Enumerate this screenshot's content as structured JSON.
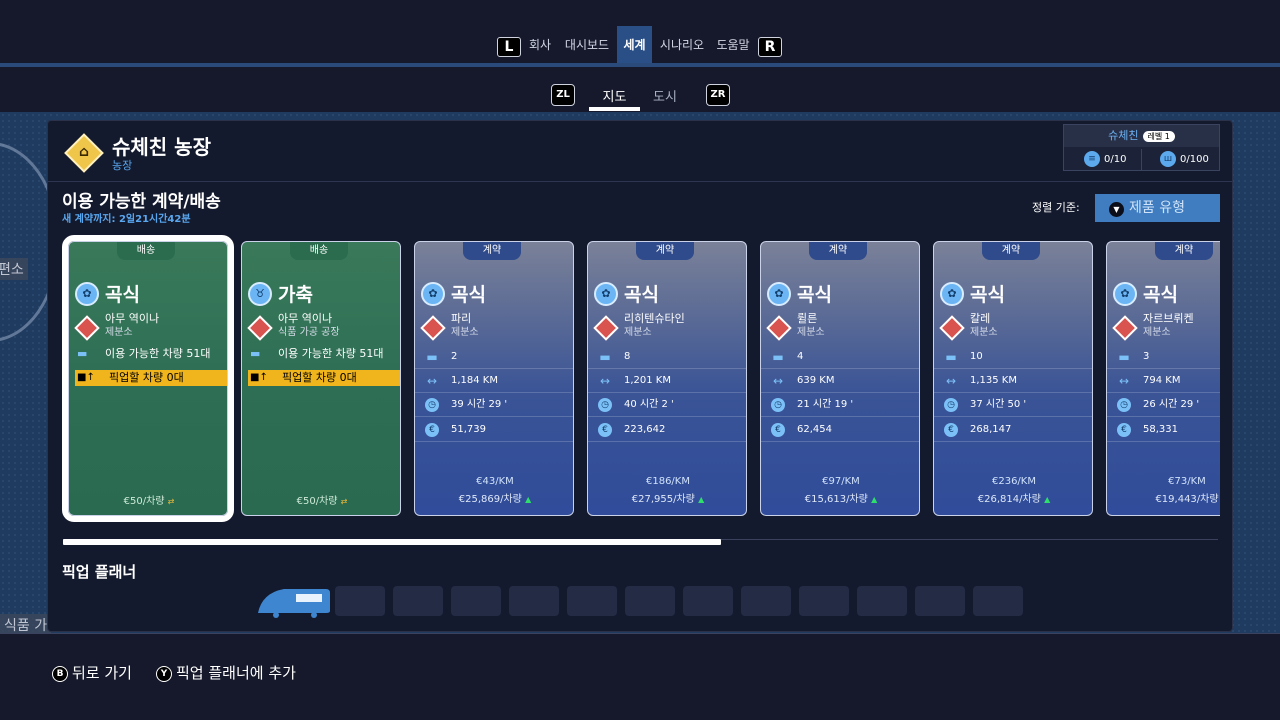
{
  "top_nav": {
    "left_button": "L",
    "right_button": "R",
    "tabs": [
      {
        "label": "회사",
        "active": false
      },
      {
        "label": "대시보드",
        "active": false
      },
      {
        "label": "세계",
        "active": true
      },
      {
        "label": "시나리오",
        "active": false
      },
      {
        "label": "도움말",
        "active": false
      }
    ]
  },
  "sub_nav": {
    "left_button": "ZL",
    "right_button": "ZR",
    "tabs": [
      {
        "label": "지도",
        "active": true
      },
      {
        "label": "도시",
        "active": false
      }
    ]
  },
  "map_labels": [
    "편소",
    "식품 가"
  ],
  "farm": {
    "icon": "farm-icon",
    "name": "슈체친 농장",
    "type": "농장",
    "info": {
      "city": "슈체친",
      "level": "레벨 1",
      "stat1": "0/10",
      "stat2": "0/100"
    }
  },
  "section": {
    "title": "이용 가능한 계약/배송",
    "new_contract": "새 계약까지: 2일21시간42분",
    "sort_label": "정렬 기준:",
    "sort_value": "제품 유형"
  },
  "cards": [
    {
      "kind": "배송",
      "category": "곡식",
      "dest": "아무 역이나",
      "dest_sub": "제분소",
      "available": "이용 가능한 차량 51대",
      "pickup": "픽업할 차량 0대",
      "price": "€50/차량"
    },
    {
      "kind": "배송",
      "category": "가축",
      "dest": "아무 역이나",
      "dest_sub": "식품 가공 공장",
      "available": "이용 가능한 차량 51대",
      "pickup": "픽업할 차량 0대",
      "price": "€50/차량"
    },
    {
      "kind": "계약",
      "category": "곡식",
      "dest": "파리",
      "dest_sub": "제분소",
      "vehicles": "2",
      "distance": "1,184 KM",
      "time": "39 시간 29 '",
      "money": "51,739",
      "rate": "€43/KM",
      "price": "€25,869/차량"
    },
    {
      "kind": "계약",
      "category": "곡식",
      "dest": "리히텐슈타인",
      "dest_sub": "제분소",
      "vehicles": "8",
      "distance": "1,201 KM",
      "time": "40 시간 2 '",
      "money": "223,642",
      "rate": "€186/KM",
      "price": "€27,955/차량"
    },
    {
      "kind": "계약",
      "category": "곡식",
      "dest": "륄른",
      "dest_sub": "제분소",
      "vehicles": "4",
      "distance": "639 KM",
      "time": "21 시간 19 '",
      "money": "62,454",
      "rate": "€97/KM",
      "price": "€15,613/차량"
    },
    {
      "kind": "계약",
      "category": "곡식",
      "dest": "칼레",
      "dest_sub": "제분소",
      "vehicles": "10",
      "distance": "1,135 KM",
      "time": "37 시간 50 '",
      "money": "268,147",
      "rate": "€236/KM",
      "price": "€26,814/차량"
    },
    {
      "kind": "계약",
      "category": "곡식",
      "dest": "자르브뤼켄",
      "dest_sub": "제분소",
      "vehicles": "3",
      "distance": "794 KM",
      "time": "26 시간 29 '",
      "money": "58,331",
      "rate": "€73/KM",
      "price": "€19,443/차량"
    }
  ],
  "scroll_position": 0.57,
  "planner": {
    "title": "픽업 플래너",
    "slots": 12
  },
  "bottom": {
    "back_button": "B",
    "back_label": "뒤로 가기",
    "add_button": "Y",
    "add_label": "픽업 플래너에 추가"
  },
  "colors": {
    "accent_blue": "#3f7dc0",
    "delivery_green": "#2e6e55",
    "contract_blue": "#304c9a",
    "pickup_yellow": "#f0b41c"
  }
}
